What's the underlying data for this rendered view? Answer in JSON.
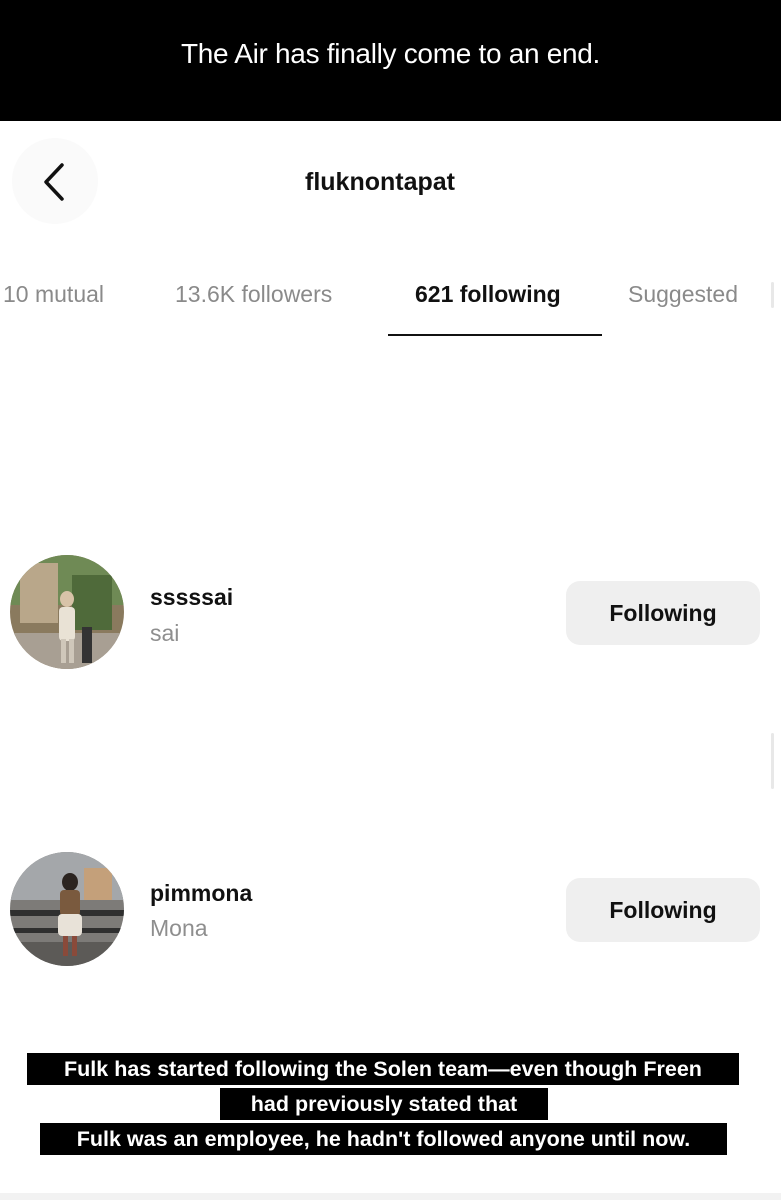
{
  "banner": {
    "text": "The Air has finally come to an end."
  },
  "header": {
    "back_icon": "chevron-left-icon",
    "title": "fluknontapat"
  },
  "tabs": [
    {
      "label": "10 mutual",
      "active": false
    },
    {
      "label": "13.6K followers",
      "active": false
    },
    {
      "label": "621 following",
      "active": true
    },
    {
      "label": "Suggested",
      "active": false
    }
  ],
  "list": [
    {
      "username": "sssssai",
      "display_name": "sai",
      "button_label": "Following"
    },
    {
      "username": "pimmona",
      "display_name": "Mona",
      "button_label": "Following"
    }
  ],
  "caption": {
    "lines": [
      "Fulk has started following the Solen team—even though Freen",
      "had previously stated that",
      "Fulk was an employee, he hadn't followed anyone until now."
    ]
  },
  "colors": {
    "banner_bg": "#000000",
    "button_bg": "#efefef",
    "muted_text": "#8e8e8e"
  }
}
